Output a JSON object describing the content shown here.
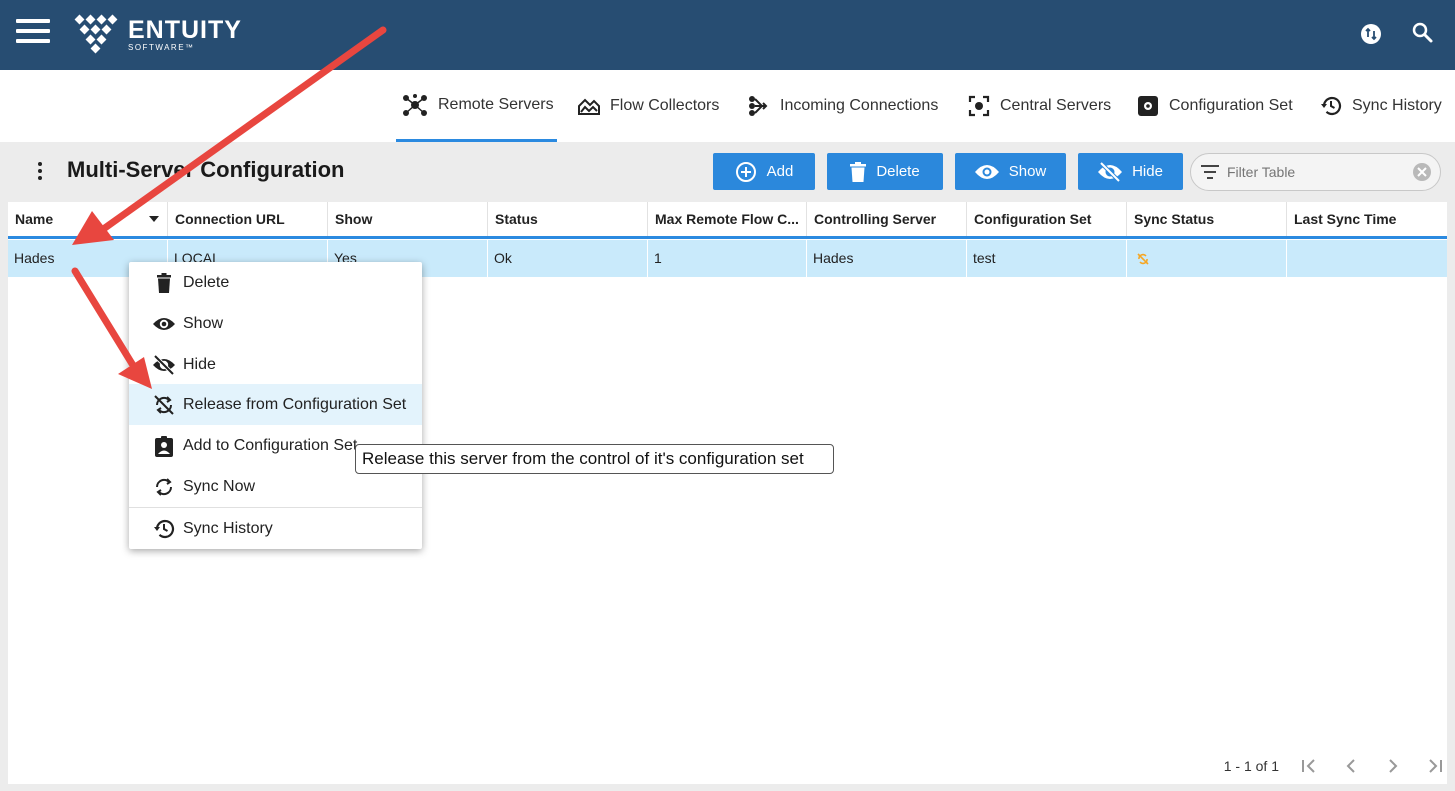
{
  "header": {
    "brand_name": "ENTUITY",
    "brand_sub": "SOFTWARE™",
    "menu_icon": "hamburger-icon",
    "sync_icon": "sync-badge-icon",
    "search_icon": "search-icon"
  },
  "tabs": [
    {
      "label": "Remote Servers",
      "icon": "network-hub-icon",
      "active": true
    },
    {
      "label": "Flow Collectors",
      "icon": "flow-collector-icon",
      "active": false
    },
    {
      "label": "Incoming Connections",
      "icon": "incoming-connections-icon",
      "active": false
    },
    {
      "label": "Central Servers",
      "icon": "central-server-icon",
      "active": false
    },
    {
      "label": "Configuration Set",
      "icon": "configuration-set-icon",
      "active": false
    },
    {
      "label": "Sync History",
      "icon": "history-icon",
      "active": false
    }
  ],
  "toolbar": {
    "title": "Multi-Server Configuration",
    "add_label": "Add",
    "delete_label": "Delete",
    "show_label": "Show",
    "hide_label": "Hide",
    "filter_placeholder": "Filter Table"
  },
  "table": {
    "columns": [
      "Name",
      "Connection URL",
      "Show",
      "Status",
      "Max Remote Flow C...",
      "Controlling Server",
      "Configuration Set",
      "Sync Status",
      "Last Sync Time"
    ],
    "rows": [
      {
        "name": "Hades",
        "connection_url": "LOCAL",
        "show": "Yes",
        "status": "Ok",
        "max_remote_flow": "1",
        "controlling_server": "Hades",
        "configuration_set": "test",
        "sync_status_icon": "sync-released-icon",
        "last_sync_time": ""
      }
    ]
  },
  "context_menu": {
    "items": [
      {
        "label": "Delete",
        "icon": "trash-icon"
      },
      {
        "label": "Show",
        "icon": "eye-icon"
      },
      {
        "label": "Hide",
        "icon": "eye-off-icon"
      },
      {
        "label": "Release from Configuration Set",
        "icon": "sync-disabled-icon"
      },
      {
        "label": "Add to Configuration Set",
        "icon": "assignment-add-icon"
      },
      {
        "label": "Sync Now",
        "icon": "sync-icon"
      },
      {
        "label": "Sync History",
        "icon": "history-icon"
      }
    ],
    "tooltip": "Release this server from the control of it's configuration set"
  },
  "pagination": {
    "range_text": "1 - 1 of 1"
  },
  "colors": {
    "header_bg": "#274d72",
    "accent": "#2b88dc",
    "row_selected": "#c9eafb",
    "annotation_arrow": "#e8463f",
    "sync_status": "#f5a623"
  }
}
